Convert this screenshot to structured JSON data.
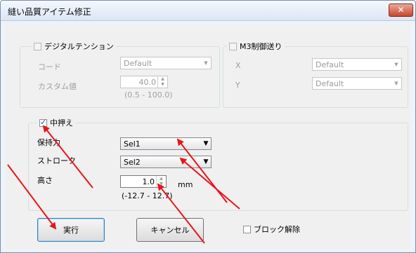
{
  "window": {
    "title": "縫い品質アイテム修正",
    "close_glyph": "✕"
  },
  "digital_tension": {
    "title": "デジタルテンション",
    "checked": false,
    "code_label": "コード",
    "code_value": "Default",
    "custom_label": "カスタム値",
    "custom_value": "40.0",
    "custom_range": "(0.5 - 100.0)"
  },
  "m3_feed": {
    "title": "M3制御送り",
    "checked": false,
    "x_label": "X",
    "x_value": "Default",
    "y_label": "Y",
    "y_value": "Default"
  },
  "presser": {
    "title": "中押え",
    "checked": true,
    "hold_label": "保持力",
    "hold_value": "Sel1",
    "stroke_label": "ストローク",
    "stroke_value": "Sel2",
    "height_label": "高さ",
    "height_value": "1.0",
    "height_unit": "mm",
    "height_range": "(-12.7 - 12.7)"
  },
  "buttons": {
    "execute": "実行",
    "cancel": "キャンセル"
  },
  "block_release": {
    "label": "ブロック解除",
    "checked": false
  },
  "annotation": {
    "arrow_color": "#e8141c"
  }
}
